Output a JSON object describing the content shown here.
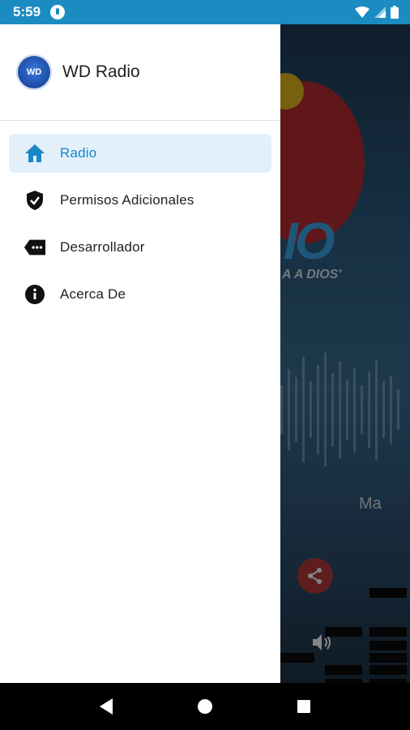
{
  "status_bar": {
    "time": "5:59",
    "icons": [
      "mic-icon",
      "wifi-icon",
      "signal-icon",
      "battery-icon"
    ]
  },
  "drawer": {
    "app_name": "WD Radio",
    "app_logo_text": "WD",
    "items": [
      {
        "label": "Radio",
        "icon": "home-icon",
        "active": true
      },
      {
        "label": "Permisos Adicionales",
        "icon": "shield-check-icon",
        "active": false
      },
      {
        "label": "Desarrollador",
        "icon": "tag-dots-icon",
        "active": false
      },
      {
        "label": "Acerca De",
        "icon": "info-icon",
        "active": false
      }
    ]
  },
  "background_player": {
    "logo_partial_text": "IO",
    "logo_tagline_partial": "A A DIOS'",
    "now_playing_partial": "Ma"
  },
  "colors": {
    "status_bar": "#1b8cc1",
    "accent": "#1b86c5",
    "active_bg": "#e3f0fa",
    "share_fab": "#b53a3a"
  },
  "nav_bar": {
    "buttons": [
      "back-icon",
      "home-circle-icon",
      "recents-icon"
    ]
  }
}
